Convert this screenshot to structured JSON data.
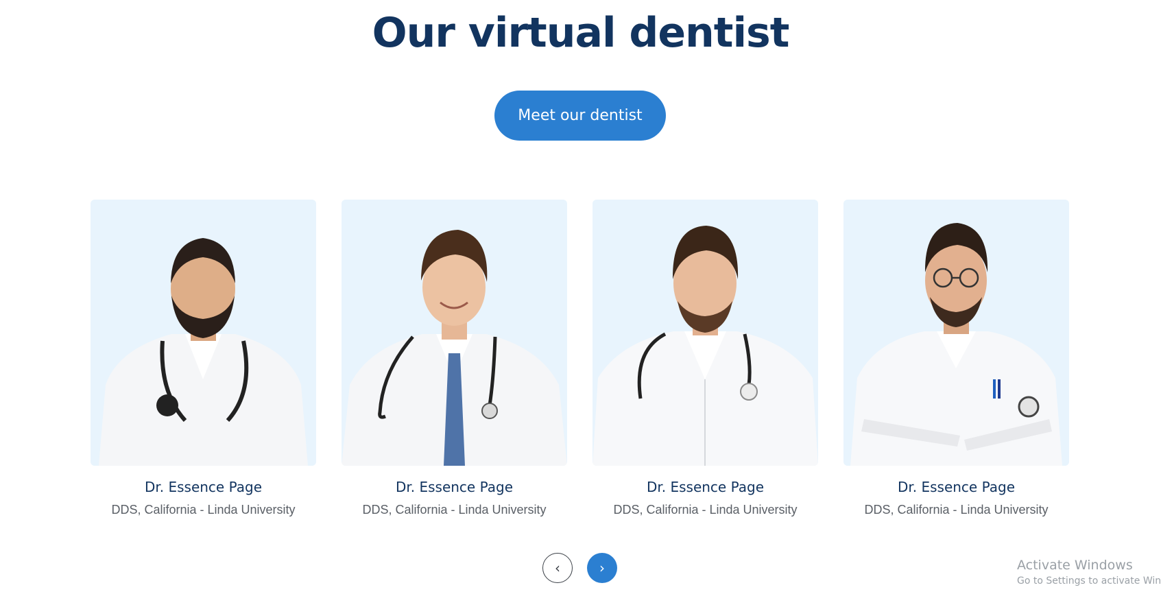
{
  "section": {
    "title": "Our virtual dentist",
    "cta_label": "Meet our dentist"
  },
  "dentists": [
    {
      "name": "Dr. Essence Page",
      "credentials": "DDS, California - Linda University",
      "photo_icon": "doctor-portrait-bearded-smiling",
      "attire": "white coat, dark stethoscope"
    },
    {
      "name": "Dr. Essence Page",
      "credentials": "DDS, California - Linda University",
      "photo_icon": "doctor-portrait-blue-tie",
      "attire": "white coat, blue tie, stethoscope"
    },
    {
      "name": "Dr. Essence Page",
      "credentials": "DDS, California - Linda University",
      "photo_icon": "doctor-portrait-stethoscope",
      "attire": "white coat, stethoscope"
    },
    {
      "name": "Dr. Essence Page",
      "credentials": "DDS, California - Linda University",
      "photo_icon": "doctor-portrait-glasses",
      "attire": "white coat, glasses, arms crossed"
    }
  ],
  "carousel": {
    "prev_icon": "chevron-left-icon",
    "next_icon": "chevron-right-icon",
    "prev_glyph": "‹",
    "next_glyph": "›"
  },
  "watermark": {
    "title": "Activate Windows",
    "subtitle": "Go to Settings to activate Windows."
  },
  "colors": {
    "heading": "#12345f",
    "accent": "#2b7fd1",
    "card_bg": "#e8f4fd",
    "muted_text": "#5a5f66"
  }
}
